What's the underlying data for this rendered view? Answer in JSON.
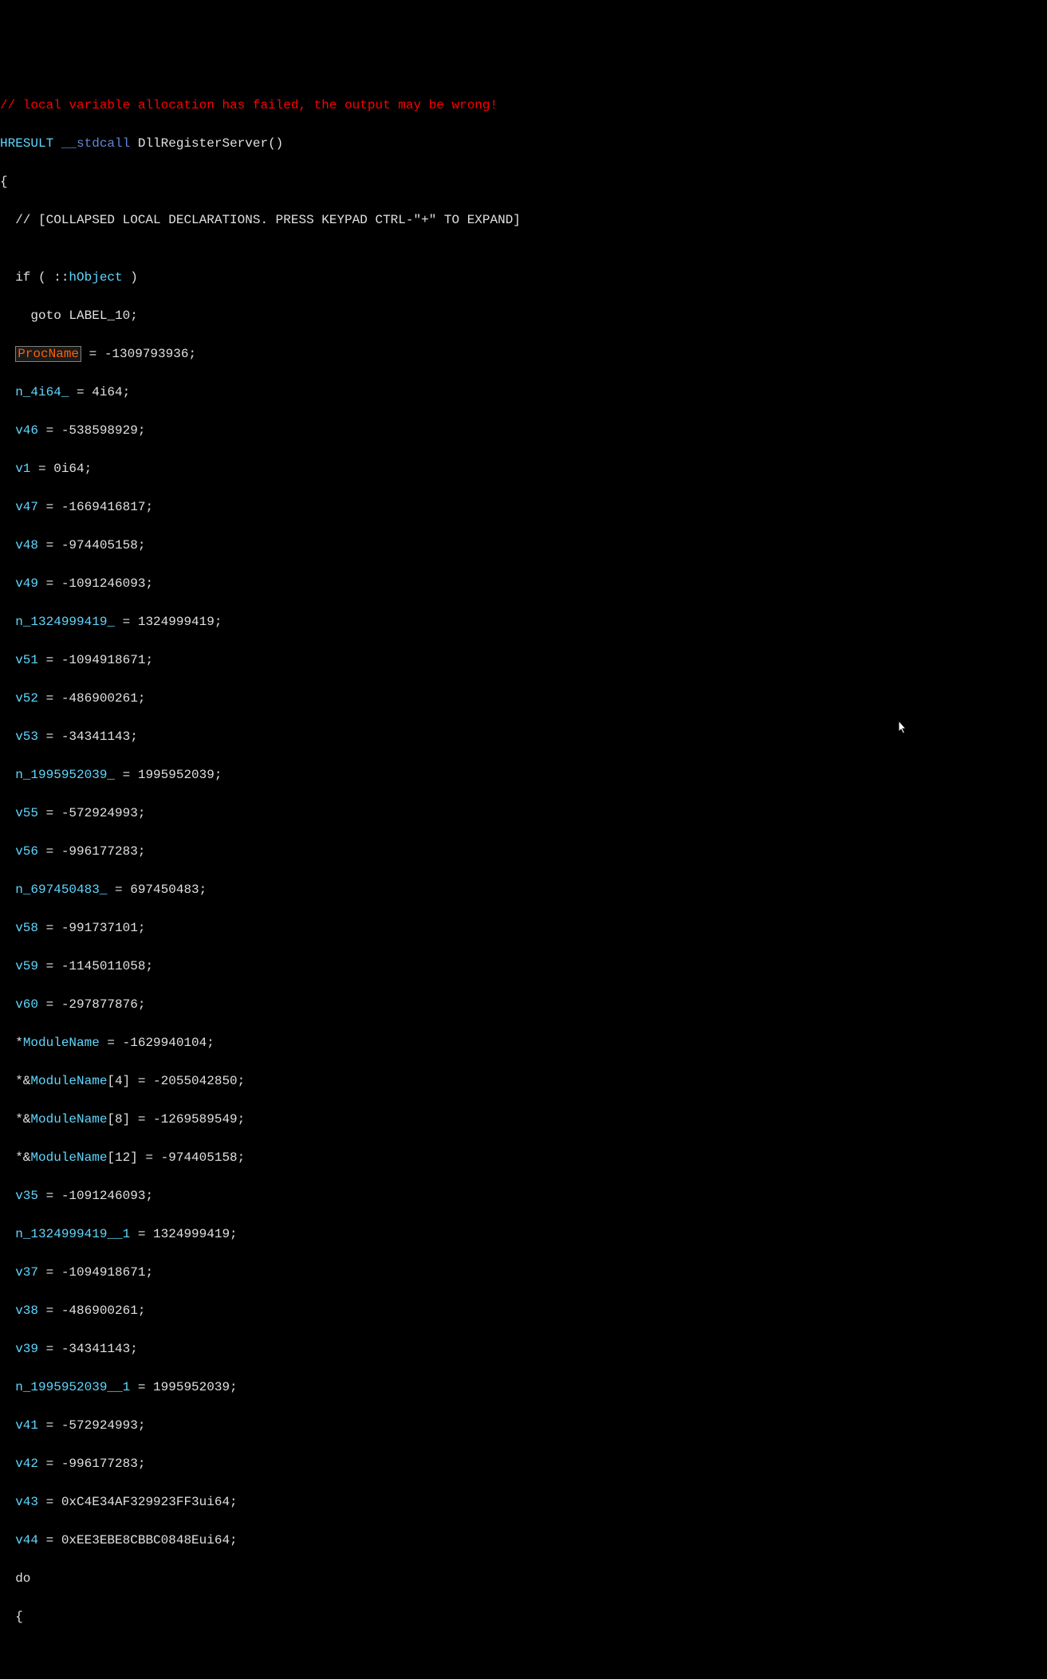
{
  "lines": {
    "l0_comment": "// local variable allocation has failed, the output may be wrong!",
    "l1_type": "HRESULT",
    "l1_call": " __stdcall ",
    "l1_fn": "DllRegisterServer",
    "l1_paren": "()",
    "l2": "{",
    "l3": "  // [COLLAPSED LOCAL DECLARATIONS. PRESS KEYPAD CTRL-\"+\" TO EXPAND]",
    "l4": "",
    "l5_a": "  if ( ::",
    "l5_b": "hObject",
    "l5_c": " )",
    "l6": "    goto LABEL_10;",
    "l7_a": "  ",
    "l7_b": "ProcName",
    "l7_c": " = -1309793936;",
    "l8_a": "  ",
    "l8_b": "n_4i64_",
    "l8_c": " = 4i64;",
    "l9_a": "  ",
    "l9_b": "v46",
    "l9_c": " = -538598929;",
    "l10_a": "  ",
    "l10_b": "v1",
    "l10_c": " = 0i64;",
    "l11_a": "  ",
    "l11_b": "v47",
    "l11_c": " = -1669416817;",
    "l12_a": "  ",
    "l12_b": "v48",
    "l12_c": " = -974405158;",
    "l13_a": "  ",
    "l13_b": "v49",
    "l13_c": " = -1091246093;",
    "l14_a": "  ",
    "l14_b": "n_1324999419_",
    "l14_c": " = 1324999419;",
    "l15_a": "  ",
    "l15_b": "v51",
    "l15_c": " = -1094918671;",
    "l16_a": "  ",
    "l16_b": "v52",
    "l16_c": " = -486900261;",
    "l17_a": "  ",
    "l17_b": "v53",
    "l17_c": " = -34341143;",
    "l18_a": "  ",
    "l18_b": "n_1995952039_",
    "l18_c": " = 1995952039;",
    "l19_a": "  ",
    "l19_b": "v55",
    "l19_c": " = -572924993;",
    "l20_a": "  ",
    "l20_b": "v56",
    "l20_c": " = -996177283;",
    "l21_a": "  ",
    "l21_b": "n_697450483_",
    "l21_c": " = 697450483;",
    "l22_a": "  ",
    "l22_b": "v58",
    "l22_c": " = -991737101;",
    "l23_a": "  ",
    "l23_b": "v59",
    "l23_c": " = -1145011058;",
    "l24_a": "  ",
    "l24_b": "v60",
    "l24_c": " = -297877876;",
    "l25_a": "  *",
    "l25_b": "ModuleName",
    "l25_c": " = -1629940104;",
    "l26_a": "  *&",
    "l26_b": "ModuleName",
    "l26_c": "[4] = -2055042850;",
    "l27_a": "  *&",
    "l27_b": "ModuleName",
    "l27_c": "[8] = -1269589549;",
    "l28_a": "  *&",
    "l28_b": "ModuleName",
    "l28_c": "[12] = -974405158;",
    "l29_a": "  ",
    "l29_b": "v35",
    "l29_c": " = -1091246093;",
    "l30_a": "  ",
    "l30_b": "n_1324999419__1",
    "l30_c": " = 1324999419;",
    "l31_a": "  ",
    "l31_b": "v37",
    "l31_c": " = -1094918671;",
    "l32_a": "  ",
    "l32_b": "v38",
    "l32_c": " = -486900261;",
    "l33_a": "  ",
    "l33_b": "v39",
    "l33_c": " = -34341143;",
    "l34_a": "  ",
    "l34_b": "n_1995952039__1",
    "l34_c": " = 1995952039;",
    "l35_a": "  ",
    "l35_b": "v41",
    "l35_c": " = -572924993;",
    "l36_a": "  ",
    "l36_b": "v42",
    "l36_c": " = -996177283;",
    "l37_a": "  ",
    "l37_b": "v43",
    "l37_c": " = 0xC4E34AF329923FF3ui64;",
    "l38_a": "  ",
    "l38_b": "v44",
    "l38_c": " = 0xEE3EBE8CBBC0848Eui64;",
    "l39": "  do",
    "l40": "  {"
  }
}
